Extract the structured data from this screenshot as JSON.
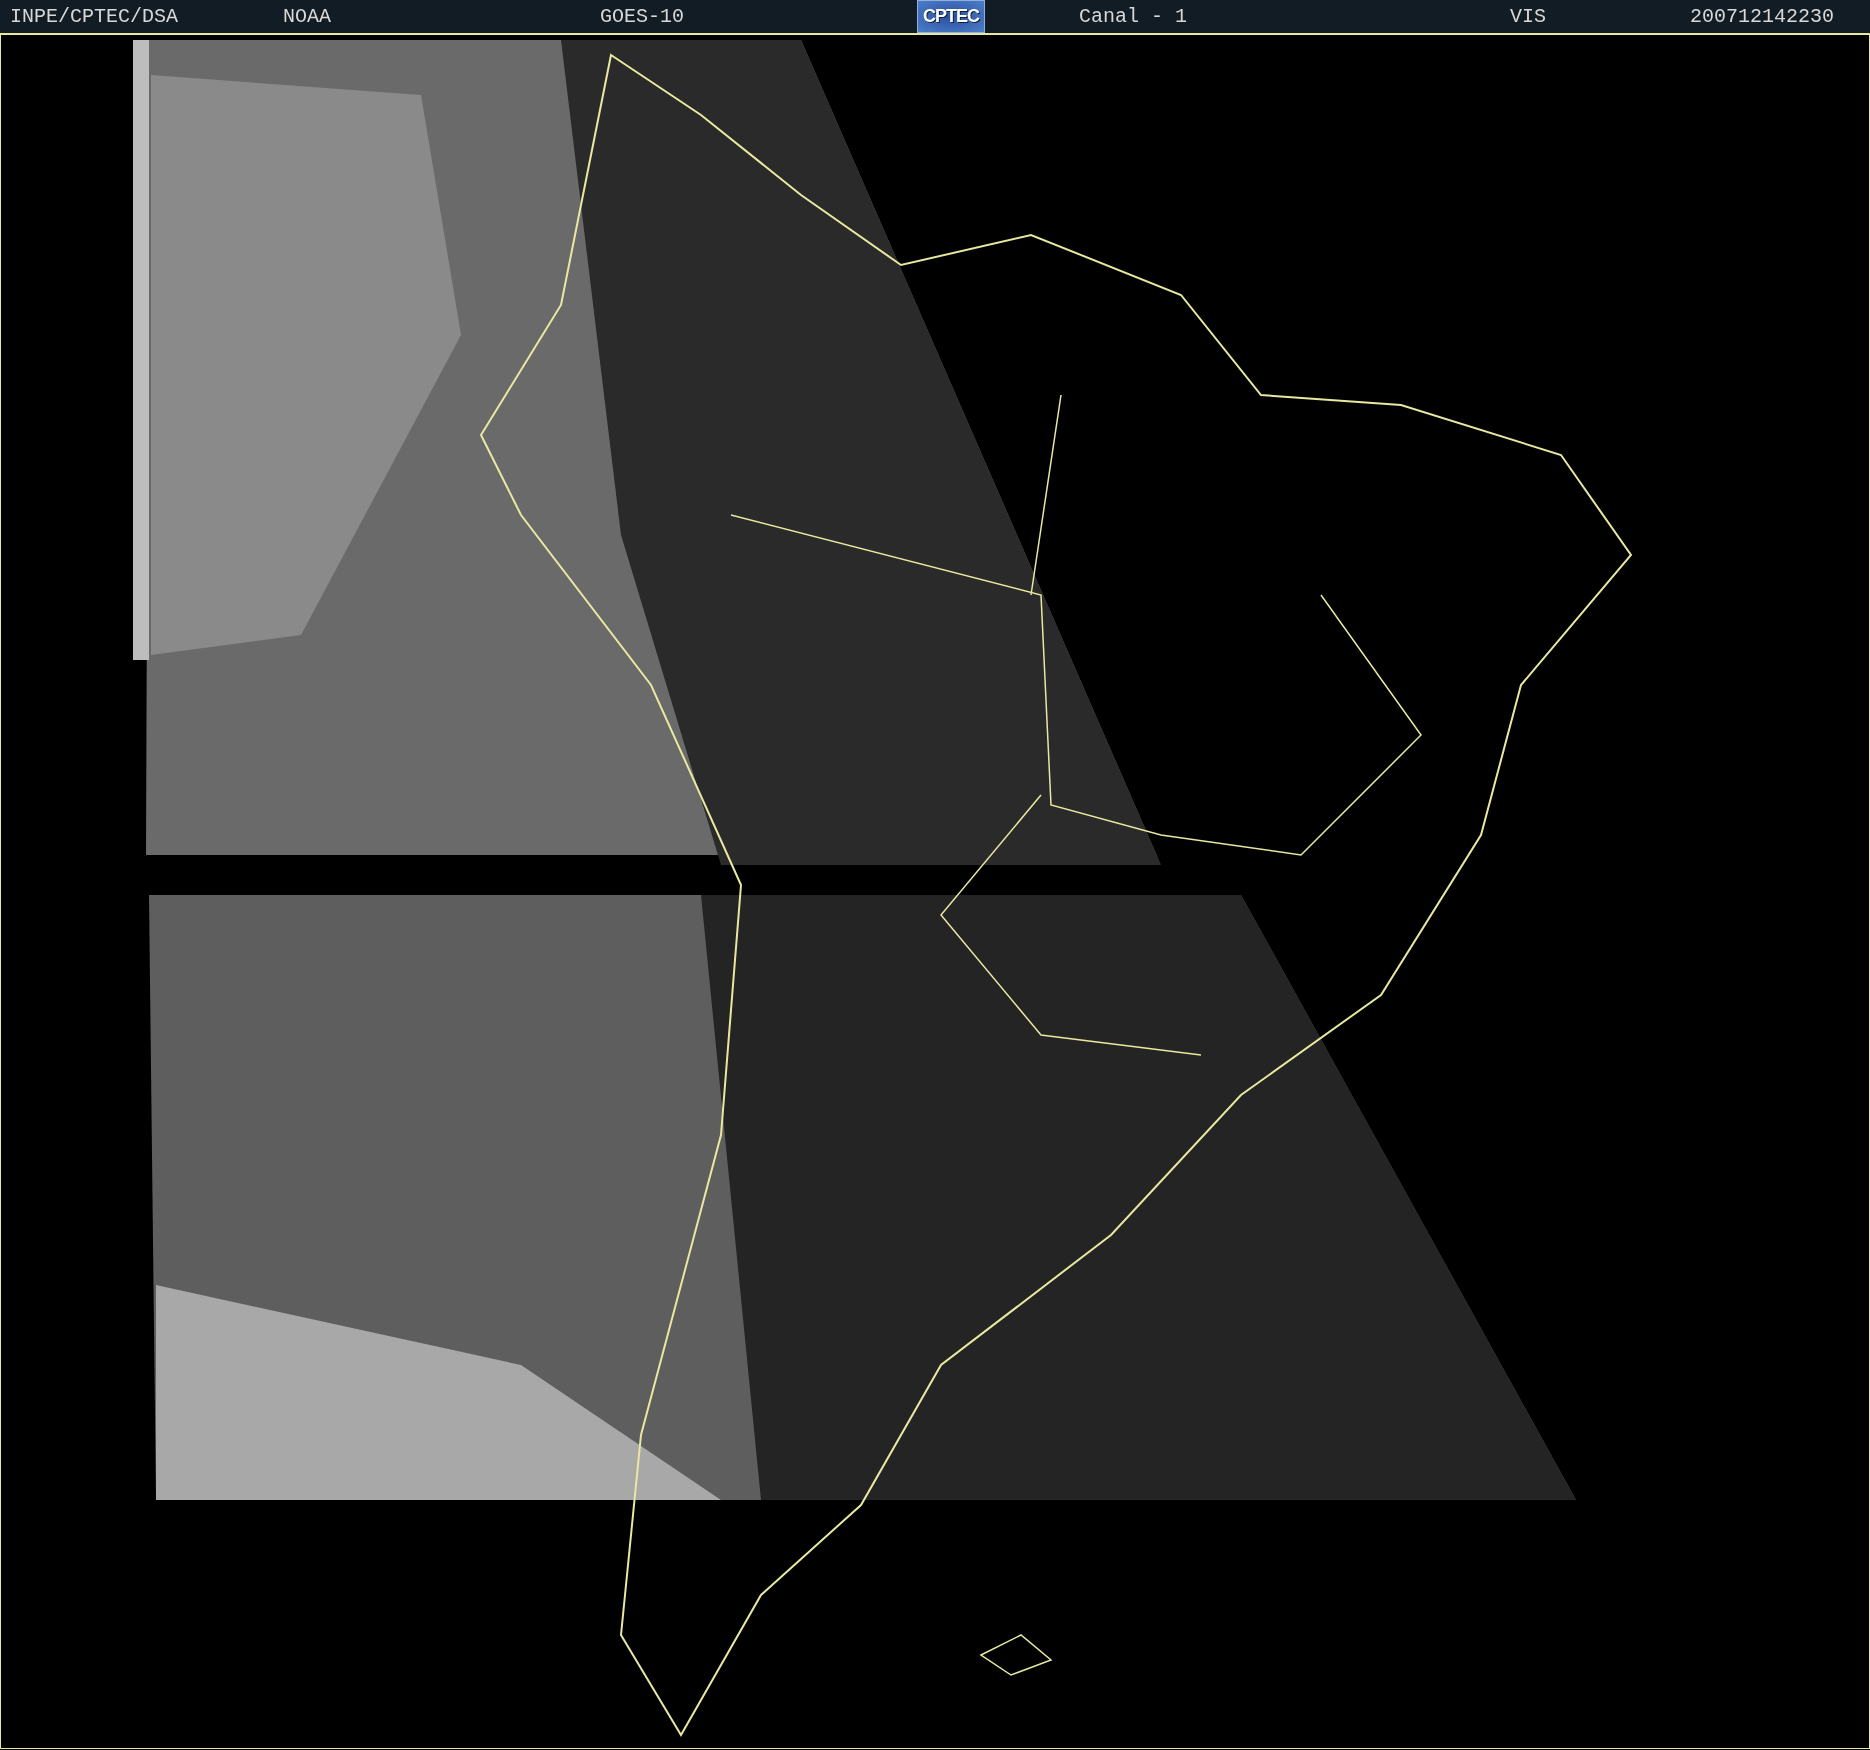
{
  "header": {
    "items": [
      {
        "kind": "text",
        "text": "INPE/CPTEC/DSA"
      },
      {
        "kind": "text",
        "text": "NOAA"
      },
      {
        "kind": "text",
        "text": "GOES-10"
      },
      {
        "kind": "logo",
        "text": "CPTEC"
      },
      {
        "kind": "text",
        "text": "Canal - 1"
      },
      {
        "kind": "text",
        "text": "VIS"
      },
      {
        "kind": "text",
        "text": "200712142230"
      }
    ]
  }
}
